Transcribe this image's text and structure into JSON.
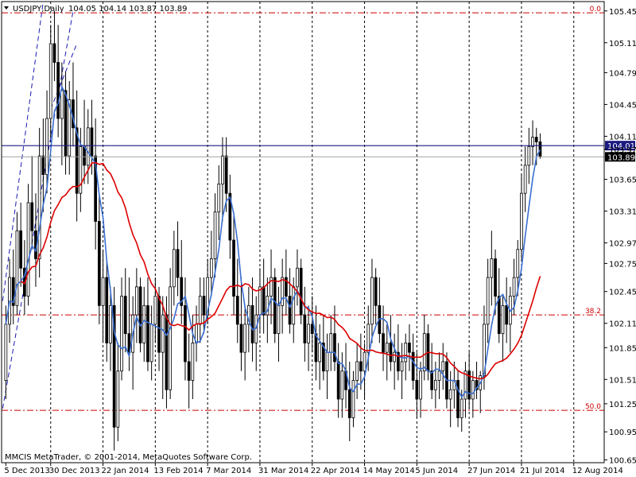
{
  "header": {
    "title": "USDJPY,Daily",
    "ohlc": "104.05 104.14 103.87 103.89"
  },
  "copyright": "MMCIS MetaTrader, © 2001-2014, MetaQuotes Software Corp.",
  "colors": {
    "background": "#ffffff",
    "bull_candle": "#000000",
    "bear_candle": "#000000",
    "fast_ma": "#3a6fd0",
    "slow_ma": "#dd0000",
    "fib_line": "#cc0000",
    "level_line": "#1a1a80",
    "bid_line": "#a0a0a0",
    "trend_channel": "#1a1ab0",
    "grid": "#000000"
  },
  "chart_data": {
    "type": "candlestick",
    "symbol": "USDJPY",
    "timeframe": "Daily",
    "ylim": [
      100.62,
      105.55
    ],
    "y_ticks": [
      "105.45",
      "105.11",
      "104.79",
      "104.45",
      "104.11",
      "103.97",
      "103.65",
      "103.31",
      "102.97",
      "102.75",
      "102.45",
      "102.11",
      "101.85",
      "101.51",
      "101.25",
      "100.95",
      "100.65"
    ],
    "x_ticks": [
      "5 Dec 2013",
      "30 Dec 2013",
      "22 Jan 2014",
      "13 Feb 2014",
      "7 Mar 2014",
      "31 Mar 2014",
      "22 Apr 2014",
      "14 May 2014",
      "5 Jun 2014",
      "27 Jun 2014",
      "21 Jul 2014",
      "12 Aug 2014"
    ],
    "x_tick_index": [
      0,
      12,
      26,
      40,
      54,
      68,
      82,
      96,
      110,
      124,
      138,
      152
    ],
    "bar_count": 160,
    "fib_levels": [
      {
        "label": "0.0",
        "value": 105.43
      },
      {
        "label": "38.2",
        "value": 102.2
      },
      {
        "label": "50.0",
        "value": 101.18
      }
    ],
    "horizontal_lines": [
      {
        "label": "104.01",
        "value": 104.01,
        "role": "level"
      },
      {
        "label": "103.89",
        "value": 103.89,
        "role": "bid"
      }
    ],
    "candles": [
      [
        101.5,
        102.3,
        101.3,
        102.1
      ],
      [
        102.1,
        102.8,
        101.9,
        102.6
      ],
      [
        102.6,
        102.9,
        102.1,
        102.3
      ],
      [
        102.3,
        103.3,
        102.2,
        103.1
      ],
      [
        103.1,
        103.4,
        102.5,
        102.7
      ],
      [
        102.7,
        103.0,
        102.2,
        102.4
      ],
      [
        102.4,
        103.6,
        102.3,
        103.4
      ],
      [
        103.4,
        103.9,
        102.9,
        103.1
      ],
      [
        103.1,
        103.5,
        102.5,
        102.8
      ],
      [
        102.8,
        104.2,
        102.6,
        103.9
      ],
      [
        103.9,
        104.3,
        103.3,
        103.7
      ],
      [
        103.7,
        104.6,
        103.5,
        104.3
      ],
      [
        104.3,
        105.3,
        104.1,
        105.1
      ],
      [
        105.1,
        105.45,
        104.7,
        104.9
      ],
      [
        104.9,
        105.3,
        104.1,
        104.3
      ],
      [
        104.3,
        104.9,
        103.8,
        104.6
      ],
      [
        104.6,
        104.8,
        103.7,
        103.9
      ],
      [
        103.9,
        104.7,
        103.7,
        104.5
      ],
      [
        104.5,
        104.9,
        104.0,
        104.2
      ],
      [
        104.2,
        104.6,
        103.2,
        103.5
      ],
      [
        103.5,
        104.2,
        103.3,
        104.0
      ],
      [
        104.0,
        104.5,
        103.6,
        103.8
      ],
      [
        103.8,
        104.4,
        103.6,
        104.2
      ],
      [
        104.2,
        104.5,
        103.7,
        103.9
      ],
      [
        103.9,
        104.3,
        102.9,
        103.2
      ],
      [
        103.2,
        103.5,
        102.1,
        102.3
      ],
      [
        102.3,
        102.9,
        101.9,
        102.6
      ],
      [
        102.6,
        102.8,
        101.7,
        101.9
      ],
      [
        101.9,
        102.5,
        101.6,
        102.3
      ],
      [
        102.3,
        102.5,
        100.75,
        101.0
      ],
      [
        101.0,
        101.9,
        100.85,
        101.6
      ],
      [
        101.6,
        102.6,
        101.5,
        102.4
      ],
      [
        102.4,
        102.7,
        101.8,
        102.0
      ],
      [
        102.0,
        102.6,
        101.6,
        101.8
      ],
      [
        101.8,
        102.4,
        101.4,
        102.2
      ],
      [
        102.2,
        102.7,
        101.9,
        102.5
      ],
      [
        102.5,
        102.6,
        101.8,
        101.9
      ],
      [
        101.9,
        102.5,
        101.7,
        102.3
      ],
      [
        102.3,
        102.6,
        101.6,
        101.7
      ],
      [
        101.7,
        102.3,
        101.5,
        102.1
      ],
      [
        102.1,
        102.6,
        101.9,
        102.4
      ],
      [
        102.4,
        102.5,
        101.6,
        101.8
      ],
      [
        101.8,
        102.4,
        101.3,
        102.2
      ],
      [
        102.2,
        102.4,
        101.2,
        101.4
      ],
      [
        101.4,
        102.7,
        101.3,
        102.5
      ],
      [
        102.5,
        103.1,
        102.3,
        102.9
      ],
      [
        102.9,
        103.2,
        102.4,
        102.6
      ],
      [
        102.6,
        103.0,
        102.1,
        102.3
      ],
      [
        102.3,
        102.6,
        101.5,
        101.7
      ],
      [
        101.7,
        102.0,
        101.2,
        101.5
      ],
      [
        101.5,
        102.2,
        101.3,
        101.9
      ],
      [
        101.9,
        102.3,
        101.7,
        102.1
      ],
      [
        102.1,
        102.6,
        101.9,
        102.4
      ],
      [
        102.4,
        102.6,
        102.0,
        102.2
      ],
      [
        102.2,
        102.8,
        102.1,
        102.6
      ],
      [
        102.6,
        103.1,
        102.4,
        102.8
      ],
      [
        102.8,
        103.5,
        102.6,
        103.3
      ],
      [
        103.3,
        103.8,
        103.0,
        103.6
      ],
      [
        103.6,
        104.1,
        103.2,
        103.9
      ],
      [
        103.9,
        104.1,
        103.3,
        103.5
      ],
      [
        103.5,
        103.7,
        102.8,
        103.0
      ],
      [
        103.0,
        103.3,
        102.2,
        102.4
      ],
      [
        102.4,
        102.8,
        101.9,
        102.1
      ],
      [
        102.1,
        102.6,
        101.6,
        101.8
      ],
      [
        101.8,
        102.3,
        101.5,
        102.1
      ],
      [
        102.1,
        102.5,
        101.8,
        102.3
      ],
      [
        102.3,
        102.6,
        101.7,
        101.9
      ],
      [
        101.9,
        102.4,
        101.6,
        102.2
      ],
      [
        102.2,
        102.7,
        102.0,
        102.5
      ],
      [
        102.5,
        102.8,
        102.0,
        102.2
      ],
      [
        102.2,
        102.6,
        101.9,
        102.4
      ],
      [
        102.4,
        102.9,
        102.1,
        102.6
      ],
      [
        102.6,
        102.7,
        101.9,
        102.0
      ],
      [
        102.0,
        102.5,
        101.7,
        102.3
      ],
      [
        102.3,
        102.8,
        102.0,
        102.6
      ],
      [
        102.6,
        102.9,
        102.2,
        102.4
      ],
      [
        102.4,
        102.7,
        102.0,
        102.1
      ],
      [
        102.1,
        102.6,
        101.9,
        102.5
      ],
      [
        102.5,
        102.9,
        102.3,
        102.7
      ],
      [
        102.7,
        102.8,
        102.1,
        102.2
      ],
      [
        102.2,
        102.5,
        101.7,
        101.9
      ],
      [
        101.9,
        102.3,
        101.6,
        102.1
      ],
      [
        102.1,
        102.4,
        101.8,
        102.0
      ],
      [
        102.0,
        102.3,
        101.5,
        101.7
      ],
      [
        101.7,
        102.1,
        101.4,
        101.9
      ],
      [
        101.9,
        102.2,
        101.5,
        101.6
      ],
      [
        101.6,
        102.0,
        101.3,
        101.8
      ],
      [
        101.8,
        102.2,
        101.6,
        102.0
      ],
      [
        102.0,
        102.3,
        101.6,
        101.7
      ],
      [
        101.7,
        101.9,
        101.1,
        101.3
      ],
      [
        101.3,
        101.8,
        101.1,
        101.6
      ],
      [
        101.6,
        101.9,
        101.2,
        101.4
      ],
      [
        101.4,
        101.7,
        100.85,
        101.1
      ],
      [
        101.1,
        101.6,
        101.0,
        101.5
      ],
      [
        101.5,
        101.9,
        101.3,
        101.7
      ],
      [
        101.7,
        102.0,
        101.4,
        101.6
      ],
      [
        101.6,
        101.9,
        101.3,
        101.8
      ],
      [
        101.8,
        102.3,
        101.6,
        102.1
      ],
      [
        102.1,
        102.8,
        101.9,
        102.6
      ],
      [
        102.6,
        102.7,
        102.1,
        102.3
      ],
      [
        102.3,
        102.6,
        101.9,
        102.0
      ],
      [
        102.0,
        102.3,
        101.6,
        101.8
      ],
      [
        101.8,
        102.1,
        101.5,
        101.9
      ],
      [
        101.9,
        102.2,
        101.6,
        101.7
      ],
      [
        101.7,
        102.0,
        101.4,
        101.8
      ],
      [
        101.8,
        102.1,
        101.5,
        101.6
      ],
      [
        101.6,
        101.9,
        101.3,
        101.7
      ],
      [
        101.7,
        102.0,
        101.5,
        101.9
      ],
      [
        101.9,
        102.1,
        101.6,
        101.8
      ],
      [
        101.8,
        102.0,
        101.4,
        101.5
      ],
      [
        101.5,
        101.8,
        101.1,
        101.3
      ],
      [
        101.3,
        101.7,
        101.1,
        101.6
      ],
      [
        101.6,
        102.2,
        101.5,
        102.0
      ],
      [
        102.0,
        102.1,
        101.5,
        101.6
      ],
      [
        101.6,
        101.9,
        101.3,
        101.4
      ],
      [
        101.4,
        101.7,
        101.2,
        101.5
      ],
      [
        101.5,
        101.8,
        101.3,
        101.6
      ],
      [
        101.6,
        101.9,
        101.4,
        101.7
      ],
      [
        101.7,
        101.8,
        101.2,
        101.3
      ],
      [
        101.3,
        101.6,
        101.0,
        101.4
      ],
      [
        101.4,
        101.7,
        101.2,
        101.5
      ],
      [
        101.5,
        101.6,
        101.0,
        101.1
      ],
      [
        101.1,
        101.4,
        100.95,
        101.3
      ],
      [
        101.3,
        101.7,
        101.1,
        101.6
      ],
      [
        101.6,
        101.8,
        101.2,
        101.3
      ],
      [
        101.3,
        101.6,
        101.1,
        101.5
      ],
      [
        101.5,
        101.7,
        101.3,
        101.4
      ],
      [
        101.4,
        101.6,
        101.15,
        101.55
      ],
      [
        101.55,
        102.3,
        101.4,
        102.1
      ],
      [
        102.1,
        102.8,
        101.9,
        102.6
      ],
      [
        102.6,
        103.1,
        102.3,
        102.8
      ],
      [
        102.8,
        102.9,
        102.2,
        102.4
      ],
      [
        102.4,
        102.7,
        101.9,
        102.0
      ],
      [
        102.0,
        102.4,
        101.7,
        102.3
      ],
      [
        102.3,
        102.6,
        101.9,
        102.1
      ],
      [
        102.1,
        102.5,
        101.8,
        102.4
      ],
      [
        102.4,
        102.8,
        102.2,
        102.6
      ],
      [
        102.6,
        103.0,
        102.4,
        102.9
      ],
      [
        102.9,
        103.7,
        102.8,
        103.5
      ],
      [
        103.5,
        104.0,
        103.3,
        103.8
      ],
      [
        103.8,
        104.2,
        103.6,
        104.0
      ],
      [
        104.0,
        104.28,
        103.8,
        104.1
      ],
      [
        104.1,
        104.2,
        103.8,
        104.05
      ],
      [
        104.05,
        104.14,
        103.87,
        103.89
      ]
    ],
    "series": []
  }
}
